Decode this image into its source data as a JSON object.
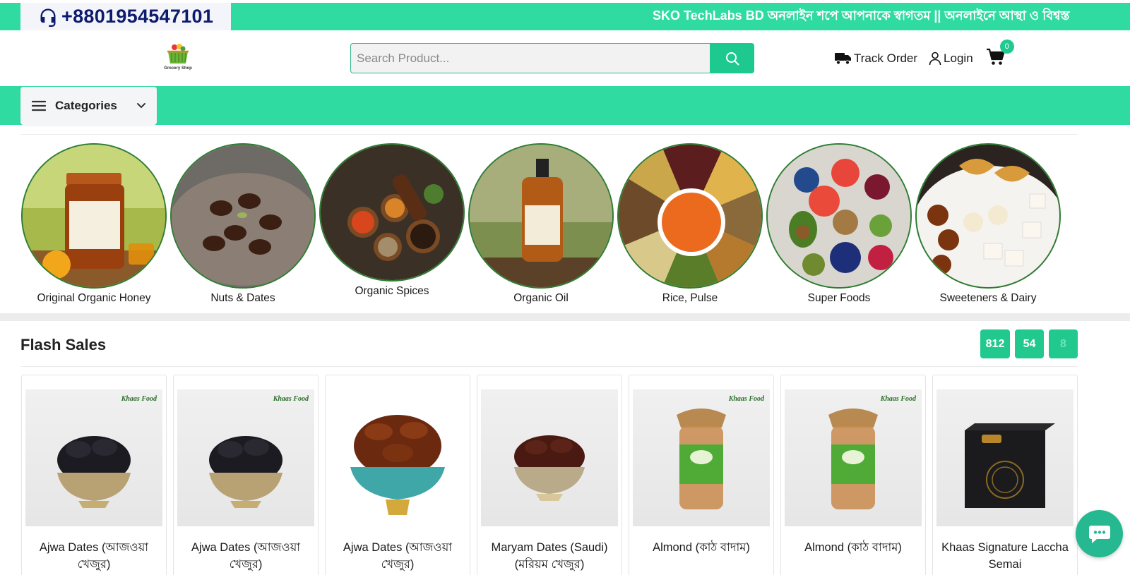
{
  "topbar": {
    "phone": "+8801954547101",
    "marquee": "SKO TechLabs BD অনলাইন শপে আপনাকে স্বাগতম || অনলাইনে আস্থা ও বিশ্বস্ত",
    "bg_color": "#2fdba0",
    "phone_icon": "headset-icon"
  },
  "header": {
    "logo_text": "Grocery Shop",
    "search_placeholder": "Search Product...",
    "track_order": "Track Order",
    "login": "Login",
    "cart_count": "0"
  },
  "nav": {
    "categories_label": "Categories"
  },
  "categories": [
    {
      "label": "Original Organic Honey"
    },
    {
      "label": "Nuts & Dates"
    },
    {
      "label": "Organic Spices"
    },
    {
      "label": "Organic Oil"
    },
    {
      "label": "Rice, Pulse"
    },
    {
      "label": "Super Foods"
    },
    {
      "label": "Sweeteners & Dairy"
    }
  ],
  "flash_sales": {
    "title": "Flash Sales",
    "timer": [
      "812",
      "54",
      "8"
    ],
    "products": [
      {
        "name": "Ajwa Dates (আজওয়া খেজুর)",
        "brand": "Khaas Food"
      },
      {
        "name": "Ajwa Dates (আজওয়া খেজুর)",
        "brand": "Khaas Food"
      },
      {
        "name": "Ajwa Dates (আজওয়া খেজুর)",
        "brand": ""
      },
      {
        "name": "Maryam Dates (Saudi) (মরিয়ম খেজুর)",
        "brand": ""
      },
      {
        "name": "Almond (কাঠ বাদাম)",
        "brand": "Khaas Food"
      },
      {
        "name": "Almond (কাঠ বাদাম)",
        "brand": "Khaas Food"
      },
      {
        "name": "Khaas Signature Laccha Semai",
        "brand": ""
      }
    ]
  },
  "colors": {
    "accent": "#2fdba0",
    "button": "#1ec98f",
    "phone_text": "#0d1b6e"
  }
}
